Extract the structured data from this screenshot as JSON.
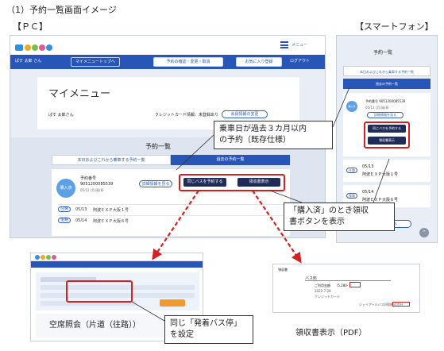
{
  "header": {
    "section_title": "（1）予約一覧画面イメージ",
    "pc_label": "【ＰＣ】",
    "sp_label": "【スマートフォン】"
  },
  "pc": {
    "user_name": "ぱす 太郎 さん",
    "nav_mymenu": "マイメニュートップへ",
    "nav_search": "予約の確認・変更・取消",
    "nav_favorite": "お気に入り登録",
    "nav_logout": "ログアウト",
    "menu_label": "メニュー",
    "page_title": "マイメニュー",
    "member_name": "ぱす 太郎さん",
    "credit_info": "クレジットカード情報：未登録あり",
    "credit_button": "会員情報の変更",
    "list_title": "予約一覧",
    "tab_future": "本日およびこれから乗車する予約一覧",
    "tab_past": "過去の予約一覧",
    "status_badge": "購入済",
    "reservation_label": "予約番号",
    "reservation_number": "9051200085539",
    "reservation_date": "05/12 (月)発(8)",
    "detail_button": "詳細情報を見る",
    "same_bus_button": "同じバスを予約する",
    "receipt_button": "領収書表示",
    "rows": [
      {
        "tag": "往路",
        "date": "05/13",
        "route": "阿波ＥＸＰ大阪１号"
      },
      {
        "tag": "復路",
        "date": "05/14",
        "route": "阿波ＥＸＰ大阪６号"
      }
    ]
  },
  "sp": {
    "title": "予約一覧",
    "tab_future": "本日およびこれから乗車する予約一覧",
    "tab_past": "過去の予約一覧",
    "status_badge": "購入済",
    "reservation_number": "予約番号 9051200085539",
    "reservation_date": "05/12 (月)発(8)",
    "detail_button": "詳細情報を見る",
    "same_bus_button": "同じバスを予約する",
    "receipt_button": "領収書表示",
    "rows": [
      {
        "tag": "往路",
        "date": "05/13",
        "route": "阿波ＥＸＰ大阪１号"
      },
      {
        "tag": "復路",
        "date": "05/14",
        "route": "阿波ＥＸＰ大阪６号"
      }
    ],
    "back_button": "トップに戻る"
  },
  "callouts": {
    "past_note_line1": "乗車日が過去３カ月以内",
    "past_note_line2": "の予約（既存仕様）",
    "receipt_note_line1": "「購入済」のとき領収",
    "receipt_note_line2": "書ボタンを表示",
    "stop_note_line1": "同じ「発着バス停」",
    "stop_note_line2": "を設定"
  },
  "captions": {
    "seat_search": "空席照会（片道（往路））",
    "receipt_pdf": "領収書表示（PDF）"
  },
  "receipt_doc": {
    "heading": "領収書",
    "subject": "バス料",
    "amount": "\\5,280-",
    "amount_label": "ご利用金額",
    "payment_date": "2022-7-28",
    "payment_method": "クレジットカード",
    "issuer": "ジェイアールバス四国株式会社"
  },
  "colors": {
    "brand_blue": "#2855b8",
    "highlight_red": "#d32020",
    "dark_button": "#1f2c57"
  }
}
